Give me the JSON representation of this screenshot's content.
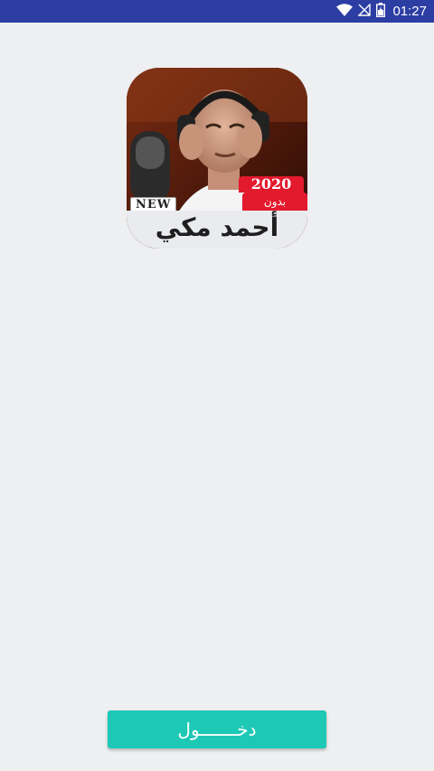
{
  "status_bar": {
    "time": "01:27",
    "icons": [
      "wifi-icon",
      "no-signal-icon",
      "battery-icon"
    ],
    "background_color": "#2c3da3"
  },
  "app_art": {
    "year_badge": "2020",
    "offline_badge": "بدون انترنيت",
    "new_badge": "NEW",
    "title": "أحمد مكي"
  },
  "login_button": {
    "label": "دخـــــــول",
    "color": "#1dc8b5"
  },
  "colors": {
    "page_background": "#eeeff0",
    "badge_red": "#e3192d"
  }
}
